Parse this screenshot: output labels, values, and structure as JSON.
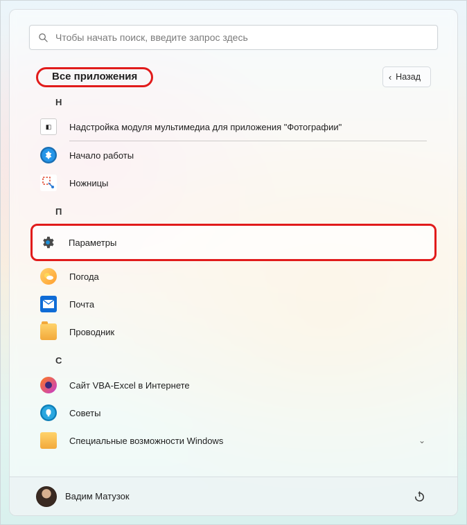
{
  "search": {
    "placeholder": "Чтобы начать поиск, введите запрос здесь"
  },
  "header": {
    "all_apps": "Все приложения",
    "back": "Назад"
  },
  "sections": [
    {
      "letter": "Н",
      "items": [
        {
          "id": "photos-addon",
          "label": "Надстройка модуля мультимедиа для приложения \"Фотографии\"",
          "icon": "photos-addon-icon",
          "truncated": true
        },
        {
          "id": "getting-started",
          "label": "Начало работы",
          "icon": "getting-started-icon"
        },
        {
          "id": "snipping",
          "label": "Ножницы",
          "icon": "snipping-icon"
        }
      ]
    },
    {
      "letter": "П",
      "items": [
        {
          "id": "settings",
          "label": "Параметры",
          "icon": "settings-icon",
          "highlighted": true
        },
        {
          "id": "weather",
          "label": "Погода",
          "icon": "weather-icon"
        },
        {
          "id": "mail",
          "label": "Почта",
          "icon": "mail-icon"
        },
        {
          "id": "explorer",
          "label": "Проводник",
          "icon": "explorer-icon"
        }
      ]
    },
    {
      "letter": "С",
      "items": [
        {
          "id": "vba-excel-site",
          "label": "Сайт VBA-Excel в Интернете",
          "icon": "firefox-icon"
        },
        {
          "id": "tips",
          "label": "Советы",
          "icon": "tips-icon"
        },
        {
          "id": "accessibility",
          "label": "Специальные возможности Windows",
          "icon": "accessibility-icon",
          "expandable": true
        }
      ]
    }
  ],
  "footer": {
    "user_name": "Вадим Матузок"
  }
}
